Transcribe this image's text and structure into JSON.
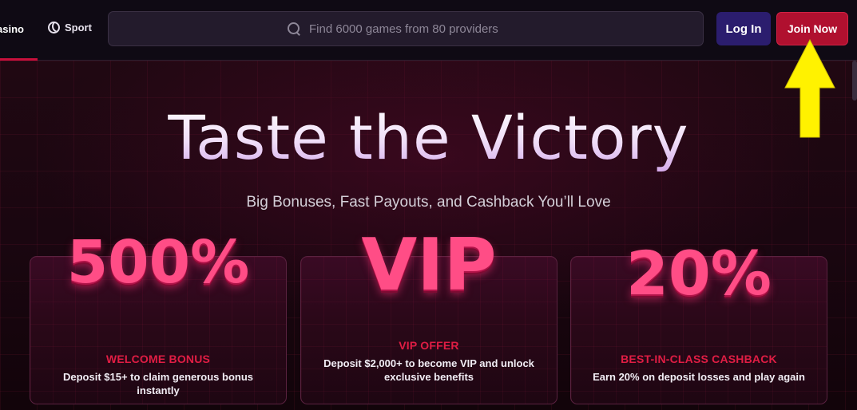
{
  "header": {
    "nav": [
      {
        "label": "asino",
        "icon": "casino-icon"
      },
      {
        "label": "Sport",
        "icon": "volleyball-icon"
      }
    ],
    "search": {
      "placeholder": "Find 6000 games from 80 providers"
    },
    "login_label": "Log In",
    "join_label": "Join Now"
  },
  "hero": {
    "title": "Taste the Victory",
    "subtitle": "Big Bonuses, Fast Payouts, and Cashback You’ll Love"
  },
  "cards": [
    {
      "big": "500%",
      "title": "WELCOME BONUS",
      "desc": "Deposit $15+ to claim generous bonus instantly"
    },
    {
      "big": "VIP",
      "title": "VIP OFFER",
      "desc": "Deposit $2,000+ to become VIP and unlock exclusive benefits"
    },
    {
      "big": "20%",
      "title": "BEST-IN-CLASS CASHBACK",
      "desc": "Earn 20% on deposit losses and play again"
    }
  ],
  "colors": {
    "accent": "#b0102f",
    "login_bg": "#2b1d6e",
    "highlight_arrow": "#fff200"
  }
}
